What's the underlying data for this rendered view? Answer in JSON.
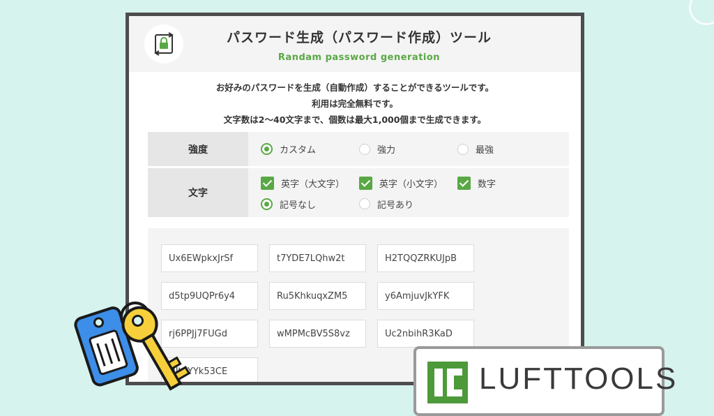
{
  "header": {
    "title": "パスワード生成（パスワード作成）ツール",
    "subtitle": "Randam password generation",
    "icon": "lock-refresh-icon"
  },
  "description": [
    "お好みのパスワードを生成（自動作成）することができるツールです。",
    "利用は完全無料です。",
    "文字数は2〜40文字まで、個数は最大1,000個まで生成できます。"
  ],
  "options": {
    "strength": {
      "label": "強度",
      "choices": [
        "カスタム",
        "強力",
        "最強"
      ],
      "selected": "カスタム"
    },
    "characters": {
      "label": "文字",
      "checkboxes": [
        {
          "label": "英字（大文字）",
          "checked": true
        },
        {
          "label": "英字（小文字）",
          "checked": true
        },
        {
          "label": "数字",
          "checked": true
        }
      ],
      "symbols": [
        {
          "label": "記号なし",
          "selected": true
        },
        {
          "label": "記号あり",
          "selected": false
        }
      ]
    }
  },
  "passwords": [
    "Ux6EWpkxJrSf",
    "t7YDE7LQhw2t",
    "H2TQQZRKUJpB",
    "d5tp9UQPr6y4",
    "Ru5KhkuqxZM5",
    "y6AmjuvJkYFK",
    "rj6PPJj7FUGd",
    "wMPMcBV5S8vz",
    "Uc2nbihR3KaD",
    "NJt4YYk53CE"
  ],
  "brand": {
    "name": "LUFTTOOLS",
    "icon": "lufttools-logo-icon"
  },
  "illustration": {
    "icon": "keys-icon"
  },
  "colors": {
    "accent": "#5aa845",
    "background": "#d6f3ee",
    "frame": "#4d4d4d"
  }
}
